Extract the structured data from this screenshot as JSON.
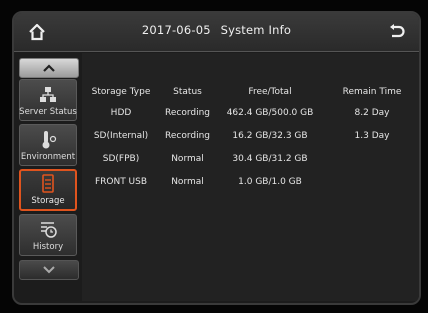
{
  "header": {
    "date": "2017-06-05",
    "title": "System Info"
  },
  "sidebar": {
    "items": [
      {
        "label": "Server Status",
        "icon": "network-icon"
      },
      {
        "label": "Environment",
        "icon": "thermometer-icon"
      },
      {
        "label": "Storage",
        "icon": "storage-icon",
        "active": true
      },
      {
        "label": "History",
        "icon": "history-icon"
      }
    ]
  },
  "table": {
    "headers": [
      "Storage Type",
      "Status",
      "Free/Total",
      "Remain Time"
    ],
    "rows": [
      [
        "HDD",
        "Recording",
        "462.4 GB/500.0 GB",
        "8.2 Day"
      ],
      [
        "SD(Internal)",
        "Recording",
        "16.2 GB/32.3 GB",
        "1.3 Day"
      ],
      [
        "SD(FPB)",
        "Normal",
        "30.4 GB/31.2 GB",
        ""
      ],
      [
        "FRONT USB",
        "Normal",
        "1.0 GB/1.0 GB",
        ""
      ]
    ]
  },
  "colors": {
    "accent": "#e0541e",
    "background": "#1c1c1c"
  }
}
